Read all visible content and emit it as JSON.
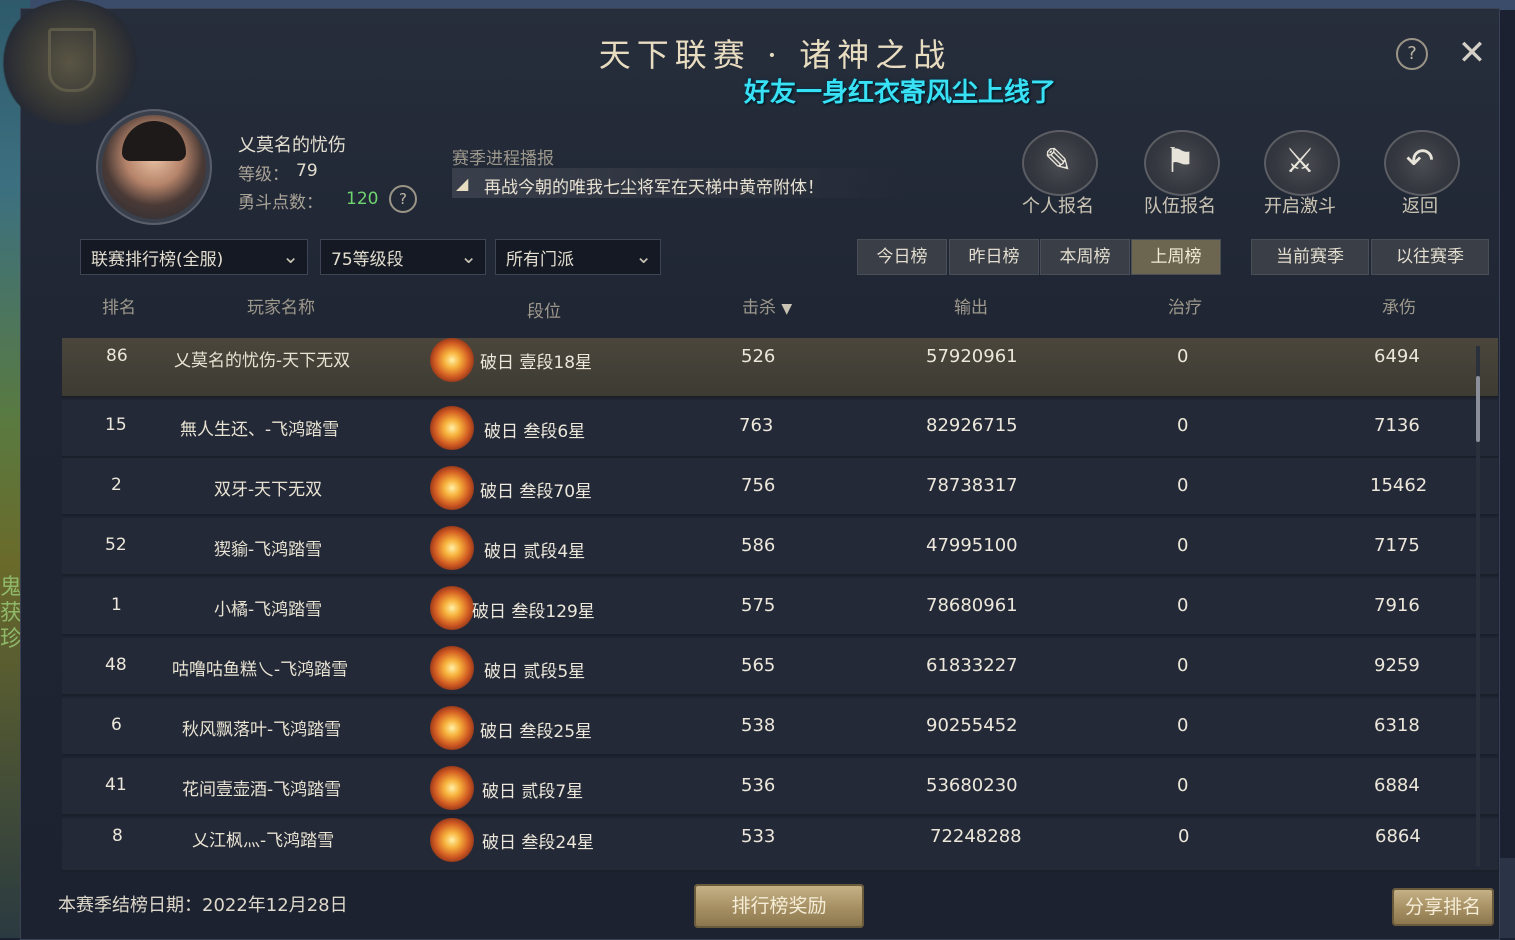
{
  "window": {
    "title": "天下联赛 · 诸神之战",
    "friend_notice": "好友一身红衣寄风尘上线了",
    "help_icon": "question-circle",
    "close_icon": "close"
  },
  "background": {
    "left_edge_text": "鬼\n获\n珍"
  },
  "player": {
    "name": "乂莫名的忧伤",
    "level_label": "等级：",
    "level": "79",
    "points_label": "勇斗点数：",
    "points": "120",
    "points_color": "#6fd36f"
  },
  "season": {
    "label": "赛季进程播报",
    "message": "再战今朝的唯我七尘将军在天梯中黄帝附体！"
  },
  "actions": [
    {
      "label": "个人报名",
      "icon": "personal-signup-icon"
    },
    {
      "label": "队伍报名",
      "icon": "team-signup-icon"
    },
    {
      "label": "开启激斗",
      "icon": "start-battle-icon"
    },
    {
      "label": "返回",
      "icon": "return-icon"
    }
  ],
  "filters": {
    "ranking_type": "联赛排行榜(全服)",
    "level_range": "75等级段",
    "sect": "所有门派"
  },
  "period_tabs": [
    "今日榜",
    "昨日榜",
    "本周榜",
    "上周榜"
  ],
  "active_period_tab": "上周榜",
  "season_tabs": [
    "当前赛季",
    "以往赛季"
  ],
  "table": {
    "headers": {
      "rank": "排名",
      "name": "玩家名称",
      "tier": "段位",
      "kills": "击杀",
      "damage": "输出",
      "healing": "治疗",
      "taken": "承伤"
    },
    "sort_indicator": "▼",
    "rows": [
      {
        "rank": "86",
        "name": "乂莫名的忧伤-天下无双",
        "tier": "破日 壹段18星",
        "kills": "526",
        "damage": "57920961",
        "healing": "0",
        "taken": "6494"
      },
      {
        "rank": "15",
        "name": "無人生还、-飞鸿踏雪",
        "tier": "破日 叁段6星",
        "kills": "763",
        "damage": "82926715",
        "healing": "0",
        "taken": "7136"
      },
      {
        "rank": "2",
        "name": "双牙-天下无双",
        "tier": "破日 叁段70星",
        "kills": "756",
        "damage": "78738317",
        "healing": "0",
        "taken": "15462"
      },
      {
        "rank": "52",
        "name": "猰貐-飞鸿踏雪",
        "tier": "破日 贰段4星",
        "kills": "586",
        "damage": "47995100",
        "healing": "0",
        "taken": "7175"
      },
      {
        "rank": "1",
        "name": "小橘-飞鸿踏雪",
        "tier": "破日 叁段129星",
        "kills": "575",
        "damage": "78680961",
        "healing": "0",
        "taken": "7916"
      },
      {
        "rank": "48",
        "name": "咕噜咕鱼糕乀-飞鸿踏雪",
        "tier": "破日 贰段5星",
        "kills": "565",
        "damage": "61833227",
        "healing": "0",
        "taken": "9259"
      },
      {
        "rank": "6",
        "name": "秋风飘落叶-飞鸿踏雪",
        "tier": "破日 叁段25星",
        "kills": "538",
        "damage": "90255452",
        "healing": "0",
        "taken": "6318"
      },
      {
        "rank": "41",
        "name": "花间壹壶酒-飞鸿踏雪",
        "tier": "破日 贰段7星",
        "kills": "536",
        "damage": "53680230",
        "healing": "0",
        "taken": "6884"
      },
      {
        "rank": "8",
        "name": "乂江枫灬-飞鸿踏雪",
        "tier": "破日 叁段24星",
        "kills": "533",
        "damage": "72248288",
        "healing": "0",
        "taken": "6864"
      }
    ]
  },
  "footer": {
    "settlement_date": "本赛季结榜日期：2022年12月28日",
    "reward_button": "排行榜奖励",
    "share_button": "分享排名"
  }
}
